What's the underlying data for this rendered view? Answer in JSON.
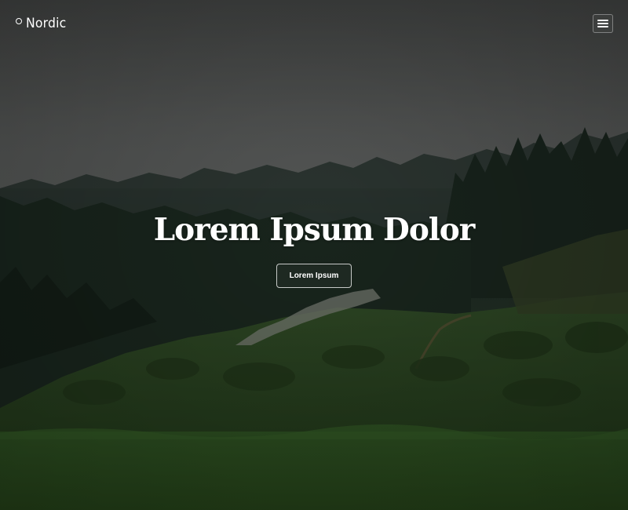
{
  "brand": {
    "name": "Nordic",
    "icon": "circle-logo-icon"
  },
  "nav": {
    "menu_icon": "hamburger-icon"
  },
  "hero": {
    "headline": "Lorem Ipsum Dolor",
    "cta_label": "Lorem Ipsum"
  },
  "colors": {
    "text": "#ffffff",
    "fog": "#555756",
    "forest": "#1d2823",
    "grass": "#2b4a1e"
  }
}
